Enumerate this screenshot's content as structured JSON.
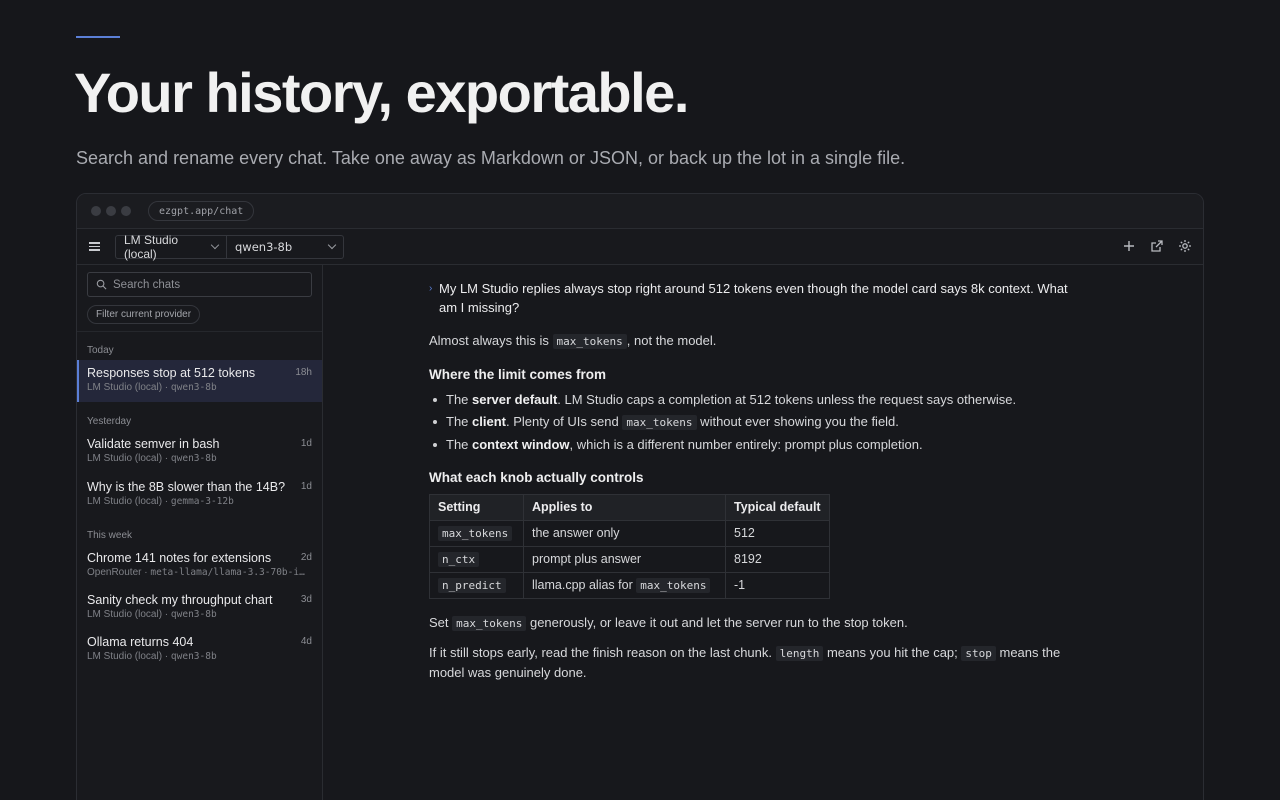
{
  "hero": {
    "title": "Your history, exportable.",
    "subtitle": "Search and rename every chat. Take one away as Markdown or JSON, or back up the lot in a single file."
  },
  "browser": {
    "url": "ezgpt.app/chat"
  },
  "toolbar": {
    "provider": "LM Studio (local)",
    "model": "qwen3-8b",
    "icons": [
      "plus-icon",
      "external-link-icon",
      "gear-icon"
    ]
  },
  "sidebar": {
    "search_placeholder": "Search chats",
    "filter_label": "Filter current provider",
    "groups": [
      {
        "label": "Today",
        "chats": [
          {
            "title": "Responses stop at 512 tokens",
            "provider": "LM Studio (local)",
            "model": "qwen3-8b",
            "age": "18h",
            "active": true
          }
        ]
      },
      {
        "label": "Yesterday",
        "chats": [
          {
            "title": "Validate semver in bash",
            "provider": "LM Studio (local)",
            "model": "qwen3-8b",
            "age": "1d"
          },
          {
            "title": "Why is the 8B slower than the 14B?",
            "provider": "LM Studio (local)",
            "model": "gemma-3-12b",
            "age": "1d"
          }
        ]
      },
      {
        "label": "This week",
        "chats": [
          {
            "title": "Chrome 141 notes for extensions",
            "provider": "OpenRouter",
            "model": "meta-llama/llama-3.3-70b-i…",
            "age": "2d"
          },
          {
            "title": "Sanity check my throughput chart",
            "provider": "LM Studio (local)",
            "model": "qwen3-8b",
            "age": "3d"
          },
          {
            "title": "Ollama returns 404",
            "provider": "LM Studio (local)",
            "model": "qwen3-8b",
            "age": "4d"
          }
        ]
      }
    ]
  },
  "conversation": {
    "user_message": "My LM Studio replies always stop right around 512 tokens even though the model card says 8k context. What am I missing?",
    "intro_before": "Almost always this is ",
    "intro_code": "max_tokens",
    "intro_after": ", not the model.",
    "heading1": "Where the limit comes from",
    "bullets": [
      {
        "pre": "The ",
        "bold": "server default",
        "post": ". LM Studio caps a completion at 512 tokens unless the request says otherwise."
      },
      {
        "pre": "The ",
        "bold": "client",
        "mid": ". Plenty of UIs send ",
        "code": "max_tokens",
        "post": " without ever showing you the field."
      },
      {
        "pre": "The ",
        "bold": "context window",
        "post": ", which is a different number entirely: prompt plus completion."
      }
    ],
    "heading2": "What each knob actually controls",
    "table": {
      "headers": [
        "Setting",
        "Applies to",
        "Typical default"
      ],
      "rows": [
        {
          "setting": "max_tokens",
          "applies": "the answer only",
          "applies_code": "",
          "default": "512"
        },
        {
          "setting": "n_ctx",
          "applies": "prompt plus answer",
          "applies_code": "",
          "default": "8192"
        },
        {
          "setting": "n_predict",
          "applies": "llama.cpp alias for ",
          "applies_code": "max_tokens",
          "default": "-1"
        }
      ]
    },
    "para2": {
      "pre": "Set ",
      "code": "max_tokens",
      "post": " generously, or leave it out and let the server run to the stop token."
    },
    "para3": {
      "pre": "If it still stops early, read the finish reason on the last chunk. ",
      "code1": "length",
      "mid": " means you hit the cap; ",
      "code2": "stop",
      "post": " means the model was genuinely done."
    }
  }
}
